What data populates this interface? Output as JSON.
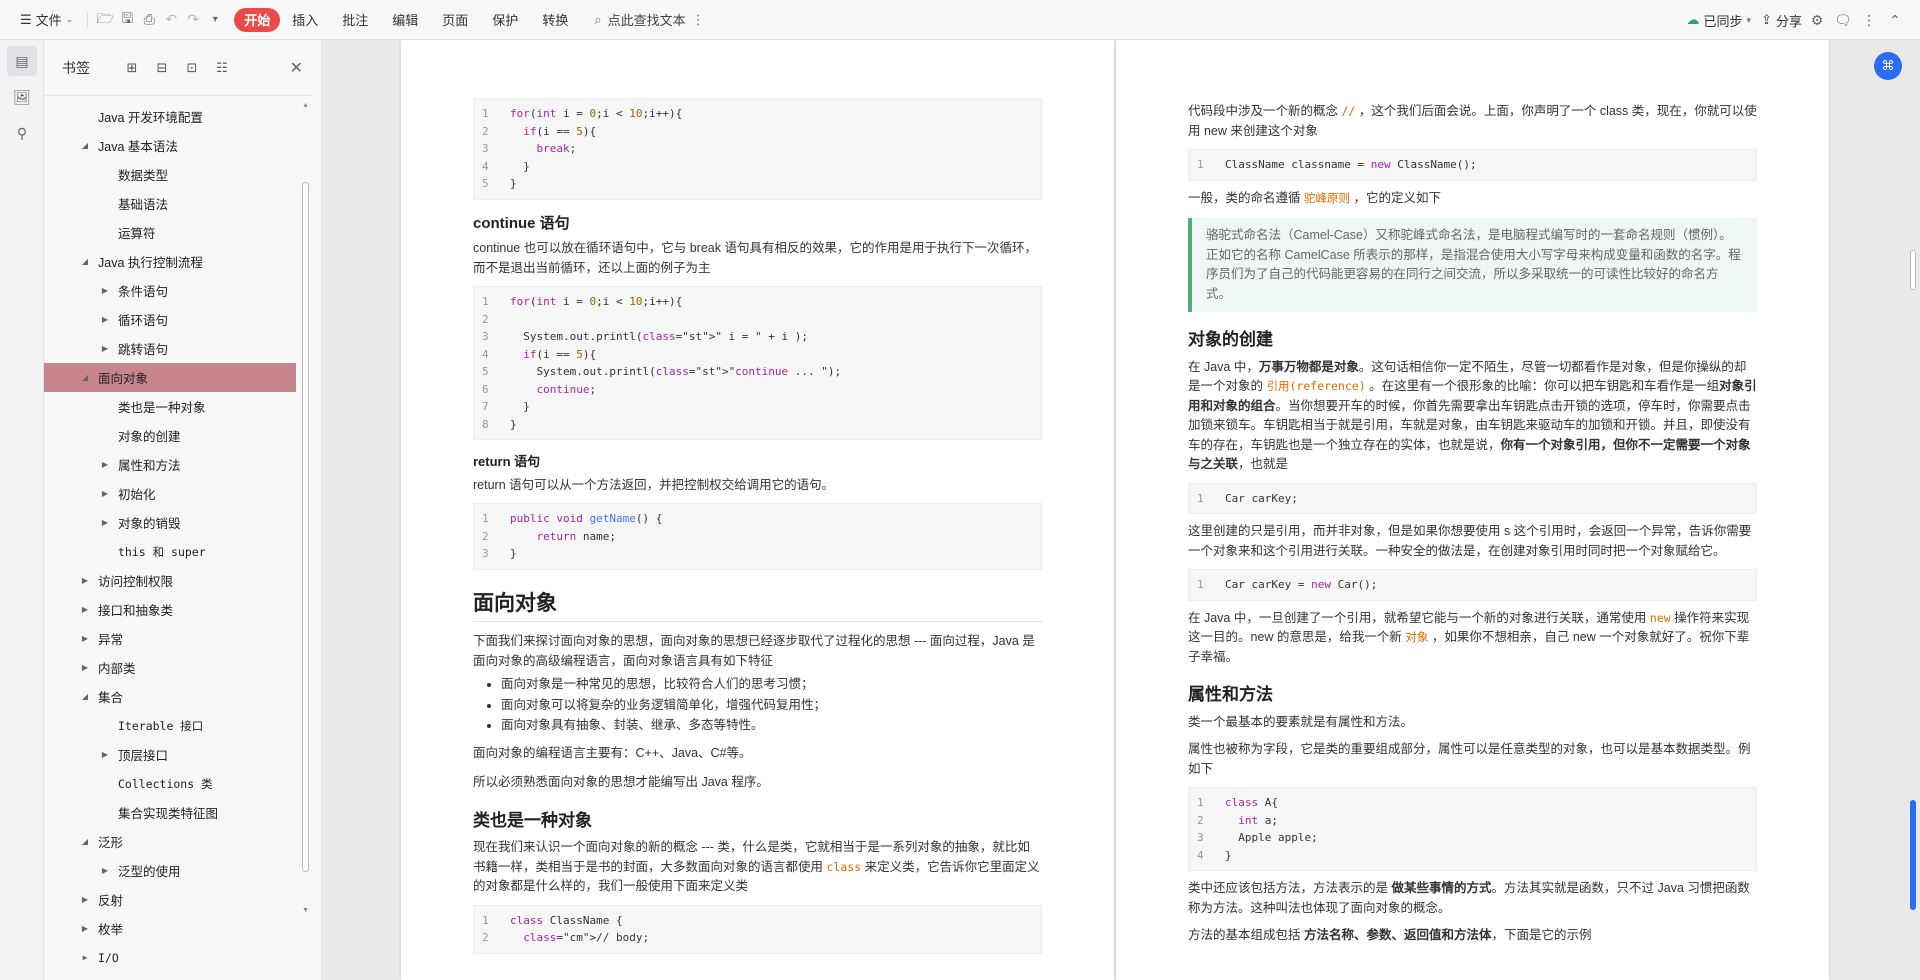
{
  "toolbar": {
    "menu_label": "文件",
    "tabs": [
      {
        "label": "开始",
        "active": true
      },
      {
        "label": "插入"
      },
      {
        "label": "批注"
      },
      {
        "label": "编辑"
      },
      {
        "label": "页面"
      },
      {
        "label": "保护"
      },
      {
        "label": "转换"
      }
    ],
    "search_label": "点此查找文本",
    "sync_label": "已同步",
    "share_label": "分享",
    "accent_color": "#e94b4b"
  },
  "sidebar": {
    "title": "书签",
    "items": [
      {
        "label": "Java 开发环境配置",
        "level": 1,
        "expand": ""
      },
      {
        "label": "Java 基本语法",
        "level": 1,
        "expand": "open"
      },
      {
        "label": "数据类型",
        "level": 2,
        "expand": ""
      },
      {
        "label": "基础语法",
        "level": 2,
        "expand": ""
      },
      {
        "label": "运算符",
        "level": 2,
        "expand": ""
      },
      {
        "label": "Java 执行控制流程",
        "level": 1,
        "expand": "open"
      },
      {
        "label": "条件语句",
        "level": 2,
        "expand": "closed"
      },
      {
        "label": "循环语句",
        "level": 2,
        "expand": "closed"
      },
      {
        "label": "跳转语句",
        "level": 2,
        "expand": "closed"
      },
      {
        "label": "面向对象",
        "level": 1,
        "expand": "open",
        "selected": true
      },
      {
        "label": "类也是一种对象",
        "level": 2,
        "expand": ""
      },
      {
        "label": "对象的创建",
        "level": 2,
        "expand": ""
      },
      {
        "label": "属性和方法",
        "level": 2,
        "expand": "closed"
      },
      {
        "label": "初始化",
        "level": 2,
        "expand": "closed"
      },
      {
        "label": "对象的销毁",
        "level": 2,
        "expand": "closed"
      },
      {
        "label": "this 和 super",
        "level": 2,
        "expand": "",
        "mono": true
      },
      {
        "label": "访问控制权限",
        "level": 1,
        "expand": "closed"
      },
      {
        "label": "接口和抽象类",
        "level": 1,
        "expand": "closed"
      },
      {
        "label": "异常",
        "level": 1,
        "expand": "closed"
      },
      {
        "label": "内部类",
        "level": 1,
        "expand": "closed"
      },
      {
        "label": "集合",
        "level": 1,
        "expand": "open"
      },
      {
        "label": "Iterable 接口",
        "level": 2,
        "expand": "",
        "mono": true
      },
      {
        "label": "顶层接口",
        "level": 2,
        "expand": "closed"
      },
      {
        "label": "Collections 类",
        "level": 2,
        "expand": "",
        "mono": true
      },
      {
        "label": "集合实现类特征图",
        "level": 2,
        "expand": ""
      },
      {
        "label": "泛形",
        "level": 1,
        "expand": "open"
      },
      {
        "label": "泛型的使用",
        "level": 2,
        "expand": "closed"
      },
      {
        "label": "反射",
        "level": 1,
        "expand": "closed"
      },
      {
        "label": "枚举",
        "level": 1,
        "expand": "closed"
      },
      {
        "label": "I/O",
        "level": 1,
        "expand": "closed",
        "mono": true
      }
    ]
  },
  "page1": {
    "code1": [
      "for(int i = 0;i < 10;i++){",
      "  if(i == 5){",
      "    break;",
      "  }",
      "}"
    ],
    "continue_heading": "continue 语句",
    "continue_text": "continue 也可以放在循环语句中，它与 break 语句具有相反的效果，它的作用是用于执行下一次循环，而不是退出当前循环，还以上面的例子为主",
    "code2": [
      "for(int i = 0;i < 10;i++){",
      "",
      "  System.out.printl(\" i = \" + i );",
      "  if(i == 5){",
      "    System.out.printl(\"continue ... \");",
      "    continue;",
      "  }",
      "}"
    ],
    "return_heading": "return 语句",
    "return_text": "return 语句可以从一个方法返回，并把控制权交给调用它的语句。",
    "code3": [
      "public void getName() {",
      "    return name;",
      "}"
    ],
    "oop_heading": "面向对象",
    "oop_intro": "下面我们来探讨面向对象的思想，面向对象的思想已经逐步取代了过程化的思想 --- 面向过程，Java 是面向对象的高级编程语言，面向对象语言具有如下特征",
    "oop_bullets": [
      "面向对象是一种常见的思想，比较符合人们的思考习惯；",
      "面向对象可以将复杂的业务逻辑简单化，增强代码复用性；",
      "面向对象具有抽象、封装、继承、多态等特性。"
    ],
    "oop_langs": "面向对象的编程语言主要有：C++、Java、C#等。",
    "oop_must": "所以必须熟悉面向对象的思想才能编写出 Java 程序。",
    "class_heading": "类也是一种对象",
    "class_text_a": "现在我们来认识一个面向对象的新的概念 --- 类，什么是类，它就相当于是一系列对象的抽象，就比如书籍一样，类相当于是书的封面，大多数面向对象的语言都使用",
    "class_kw": "class",
    "class_text_b": "来定义类，它告诉你它里面定义的对象都是什么样的，我们一般使用下面来定义类",
    "code4": [
      "class ClassName {",
      "  // body;"
    ]
  },
  "page2": {
    "intro_a": "代码段中涉及一个新的概念",
    "intro_kw": "//",
    "intro_b": "，这个我们后面会说。上面，你声明了一个 class 类，现在，你就可以使用 new 来创建这个对象",
    "code1": [
      "ClassName classname = new ClassName();"
    ],
    "naming_a": "一般，类的命名遵循",
    "naming_kw": "驼峰原则",
    "naming_b": "，它的定义如下",
    "note": "骆驼式命名法（Camel-Case）又称驼峰式命名法，是电脑程式编写时的一套命名规则（惯例）。正如它的名称 CamelCase 所表示的那样，是指混合使用大小写字母来构成变量和函数的名字。程序员们为了自己的代码能更容易的在同行之间交流，所以多采取统一的可读性比较好的命名方式。",
    "create_heading": "对象的创建",
    "create_p1_a": "在 Java 中，",
    "create_p1_b": "万事万物都是对象",
    "create_p1_c": "。这句话相信你一定不陌生，尽管一切都看作是对象，但是你操纵的却是一个对象的",
    "create_p1_kw": "引用(reference)",
    "create_p1_d": "。在这里有一个很形象的比喻：你可以把车钥匙和车看作是一组",
    "create_p1_e": "对象引用和对象的组合",
    "create_p1_f": "。当你想要开车的时候，你首先需要拿出车钥匙点击开锁的选项，停车时，你需要点击加锁来锁车。车钥匙相当于就是引用，车就是对象，由车钥匙来驱动车的加锁和开锁。并且，即使没有车的存在，车钥匙也是一个独立存在的实体，也就是说，",
    "create_p1_g": "你有一个对象引用，但你不一定需要一个对象与之关联",
    "create_p1_h": "，也就是",
    "code2": [
      "Car carKey;"
    ],
    "create_p2": "这里创建的只是引用，而并非对象，但是如果你想要使用 s 这个引用时，会返回一个异常，告诉你需要一个对象来和这个引用进行关联。一种安全的做法是，在创建对象引用时同时把一个对象赋给它。",
    "code3": [
      "Car carKey = new Car();"
    ],
    "create_p3_a": "在 Java 中，一旦创建了一个引用，就希望它能与一个新的对象进行关联，通常使用",
    "create_p3_kw": "new",
    "create_p3_b": "操作符来实现这一目的。new 的意思是，给我一个新",
    "create_p3_kw2": "对象",
    "create_p3_c": "，如果你不想相亲，自己 new 一个对象就好了。祝你下辈子幸福。",
    "attr_heading": "属性和方法",
    "attr_p1": "类一个最基本的要素就是有属性和方法。",
    "attr_p2": "属性也被称为字段，它是类的重要组成部分，属性可以是任意类型的对象，也可以是基本数据类型。例如下",
    "code4": [
      "class A{",
      "  int a;",
      "  Apple apple;",
      "}"
    ],
    "attr_p3_a": "类中还应该包括方法，方法表示的是",
    "attr_p3_b": "做某些事情的方式",
    "attr_p3_c": "。方法其实就是函数，只不过 Java 习惯把函数称为方法。这种叫法也体现了面向对象的概念。",
    "attr_p4_a": "方法的基本组成包括",
    "attr_p4_b": "方法名称、参数、返回值和方法体",
    "attr_p4_c": "，下面是它的示例"
  }
}
